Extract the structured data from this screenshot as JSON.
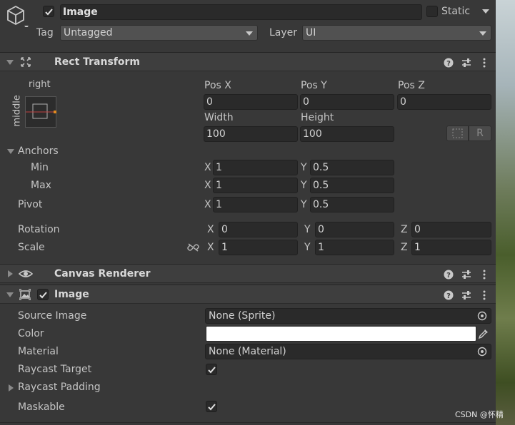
{
  "header": {
    "object_name": "Image",
    "static_label": "Static",
    "tag_label": "Tag",
    "tag_value": "Untagged",
    "layer_label": "Layer",
    "layer_value": "UI"
  },
  "rect_transform": {
    "title": "Rect Transform",
    "anchor_h": "right",
    "anchor_v": "middle",
    "pos_x_label": "Pos X",
    "pos_x": "0",
    "pos_y_label": "Pos Y",
    "pos_y": "0",
    "pos_z_label": "Pos Z",
    "pos_z": "0",
    "width_label": "Width",
    "width": "100",
    "height_label": "Height",
    "height": "100",
    "anchors_label": "Anchors",
    "min_label": "Min",
    "min_x": "1",
    "min_y": "0.5",
    "max_label": "Max",
    "max_x": "1",
    "max_y": "0.5",
    "pivot_label": "Pivot",
    "pivot_x": "1",
    "pivot_y": "0.5",
    "rotation_label": "Rotation",
    "rot_x": "0",
    "rot_y": "0",
    "rot_z": "0",
    "scale_label": "Scale",
    "scale_x": "1",
    "scale_y": "1",
    "scale_z": "1",
    "axis_x": "X",
    "axis_y": "Y",
    "axis_z": "Z",
    "raw_button": "R"
  },
  "canvas_renderer": {
    "title": "Canvas Renderer"
  },
  "image": {
    "title": "Image",
    "source_image_label": "Source Image",
    "source_image_value": "None (Sprite)",
    "color_label": "Color",
    "color_value": "#ffffff",
    "material_label": "Material",
    "material_value": "None (Material)",
    "raycast_target_label": "Raycast Target",
    "raycast_padding_label": "Raycast Padding",
    "maskable_label": "Maskable"
  },
  "watermark": "CSDN @怀精"
}
